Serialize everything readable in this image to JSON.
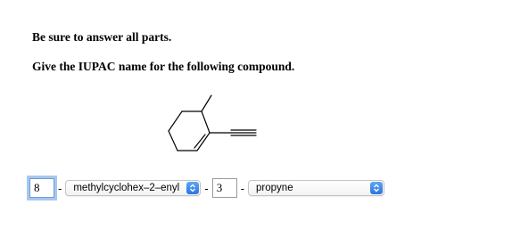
{
  "instructions": {
    "line1": "Be sure to answer all parts.",
    "line2": "Give the IUPAC name for the following compound."
  },
  "answer": {
    "locant1": {
      "value": "8"
    },
    "separator1": "-",
    "substituent_select": {
      "selected": "methylcyclohex–2–enyl"
    },
    "separator2": "-",
    "locant2": {
      "value": "3"
    },
    "separator3": "-",
    "parent_select": {
      "selected": "propyne"
    }
  },
  "icons": {
    "structure": "chemical-structure-methylcyclohexenyl-ethyne",
    "select_chevron": "up-down-chevron-icon"
  },
  "colors": {
    "select_accent": "#2b74e0",
    "focus_ring": "#a7c8ee"
  }
}
